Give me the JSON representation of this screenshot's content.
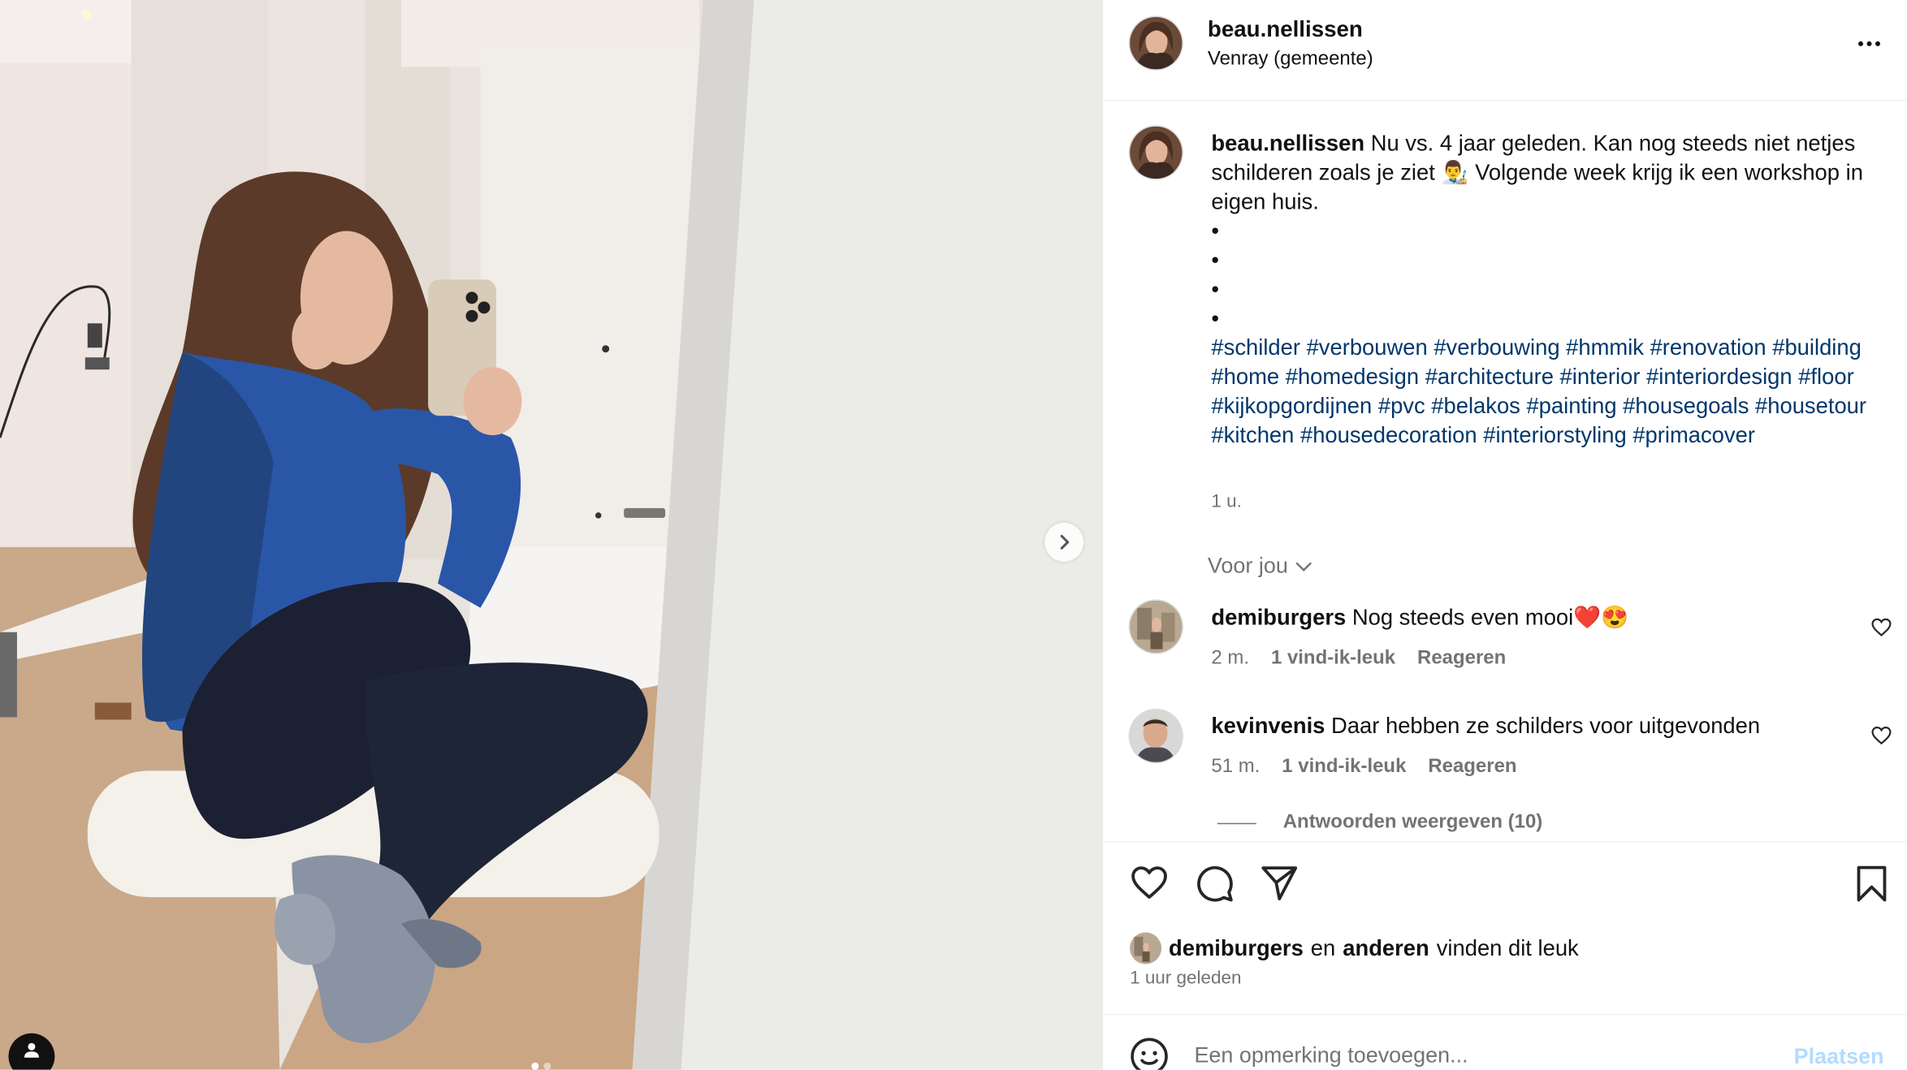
{
  "header": {
    "username": "beau.nellissen",
    "location": "Venray (gemeente)",
    "more_icon": "more-horizontal-icon"
  },
  "caption": {
    "username": "beau.nellissen",
    "text": "Nu vs. 4 jaar geleden. Kan nog steeds niet netjes schilderen zoals je ziet 👨‍🎨 Volgende week krijg ik een workshop in eigen huis.",
    "bullets": [
      "•",
      "•",
      "•",
      "•"
    ],
    "hashtags": "#schilder #verbouwen #verbouwing #hmmik #renovation #building #home #homedesign #architecture #interior #interiordesign #floor #kijkopgordijnen #pvc #belakos #painting #housegoals #housetour #kitchen #housedecoration #interiorstyling #primacover",
    "time": "1 u."
  },
  "voor_jou": "Voor jou",
  "comments": [
    {
      "username": "demiburgers",
      "text": "Nog steeds even mooi❤️😍",
      "time": "2 m.",
      "likes": "1 vind-ik-leuk",
      "reply": "Reageren"
    },
    {
      "username": "kevinvenis",
      "text": "Daar hebben ze schilders voor uitgevonden",
      "time": "51 m.",
      "likes": "1 vind-ik-leuk",
      "reply": "Reageren"
    }
  ],
  "view_replies": "Antwoorden weergeven (10)",
  "likes_summary": {
    "user": "demiburgers",
    "and": "en",
    "others": "anderen",
    "suffix": "vinden dit leuk"
  },
  "posted_time": "1 uur geleden",
  "comment_box": {
    "placeholder": "Een opmerking toevoegen...",
    "post_label": "Plaatsen"
  },
  "media": {
    "description_icons": [
      "chevron-right-icon",
      "user-tag-icon"
    ],
    "carousel_count": 2,
    "carousel_active": 0
  },
  "colors": {
    "hashtag": "#00376b",
    "muted": "#737373",
    "post_disabled": "#b3dbff",
    "jacket": "#2a56a8"
  }
}
